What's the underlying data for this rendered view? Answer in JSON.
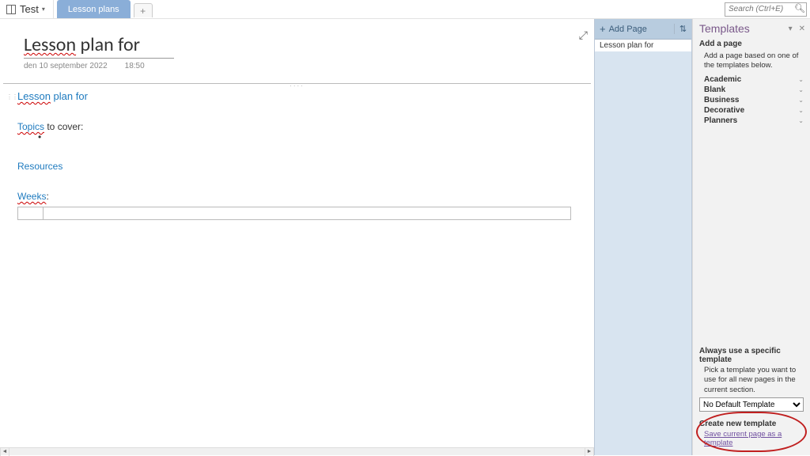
{
  "notebook": {
    "name": "Test"
  },
  "section": {
    "active": "Lesson plans"
  },
  "search": {
    "placeholder": "Search (Ctrl+E)"
  },
  "page": {
    "title_squiggle": "Lesson",
    "title_rest": " plan for",
    "date": "den 10 september 2022",
    "time": "18:50"
  },
  "content": {
    "h2_squiggle": "Lesson",
    "h2_rest": " plan for",
    "topics_squiggle": "Topics",
    "topics_rest": " to cover:",
    "resources": "Resources",
    "weeks_squiggle": "Weeks",
    "weeks_rest": ":"
  },
  "page_list": {
    "add_label": "Add Page",
    "items": [
      "Lesson plan for"
    ]
  },
  "templates": {
    "title": "Templates",
    "add_heading": "Add a page",
    "add_desc": "Add a page based on one of the templates below.",
    "categories": [
      "Academic",
      "Blank",
      "Business",
      "Decorative",
      "Planners"
    ],
    "always_h": "Always use a specific template",
    "always_desc": "Pick a template you want to use for all new pages in the current section.",
    "default_option": "No Default Template",
    "create_h": "Create new template",
    "save_link": "Save current page as a template"
  }
}
